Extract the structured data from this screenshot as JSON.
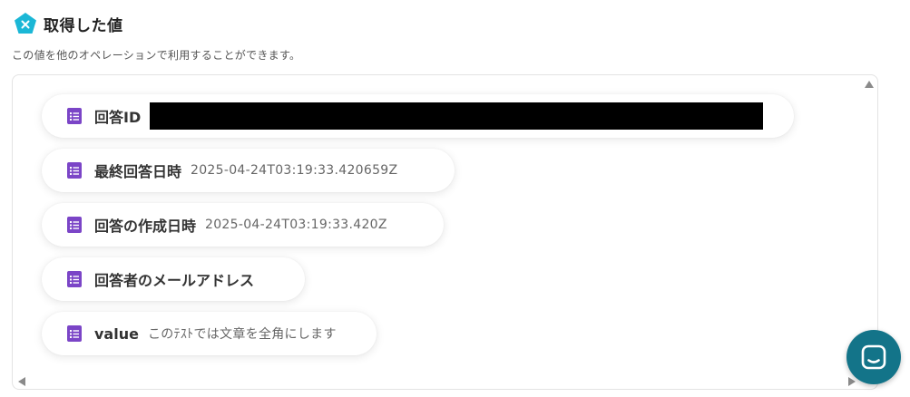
{
  "header": {
    "title": "取得した値",
    "subtitle": "この値を他のオペレーションで利用することができます。",
    "icon": "pentagon-x-icon",
    "icon_color": "#1bb7d6"
  },
  "items": [
    {
      "label": "回答ID",
      "value": "",
      "redacted": true
    },
    {
      "label": "最終回答日時",
      "value": "2025-04-24T03:19:33.420659Z"
    },
    {
      "label": "回答の作成日時",
      "value": "2025-04-24T03:19:33.420Z"
    },
    {
      "label": "回答者のメールアドレス",
      "value": ""
    },
    {
      "label": "value",
      "value": "このﾃｽﾄでは文章を全角にします"
    }
  ],
  "item_icon": "google-forms-icon",
  "item_icon_color": "#7b45c7",
  "chat": {
    "icon": "chat-icon",
    "color": "#137489"
  }
}
